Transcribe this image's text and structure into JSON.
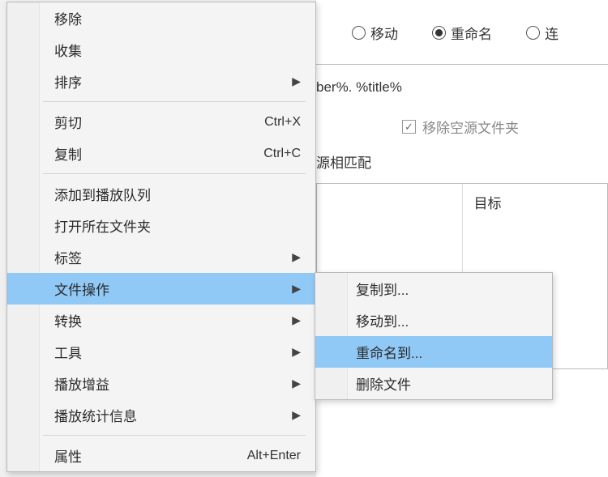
{
  "right_panel": {
    "radios": {
      "move": "移动",
      "rename": "重命名",
      "link": "连",
      "selected": "rename"
    },
    "filename_hint": "ber%. %title%",
    "checkbox_label": "移除空源文件夹",
    "match_label": "源相匹配",
    "col_source": "",
    "col_target": "目标"
  },
  "context_menu": {
    "items": [
      {
        "id": "remove",
        "label": "移除"
      },
      {
        "id": "collect",
        "label": "收集"
      },
      {
        "id": "sort",
        "label": "排序",
        "submenu": true
      },
      {
        "sep": true
      },
      {
        "id": "cut",
        "label": "剪切",
        "shortcut": "Ctrl+X"
      },
      {
        "id": "copy",
        "label": "复制",
        "shortcut": "Ctrl+C"
      },
      {
        "sep": true
      },
      {
        "id": "addqueue",
        "label": "添加到播放队列"
      },
      {
        "id": "openin",
        "label": "打开所在文件夹"
      },
      {
        "id": "tags",
        "label": "标签",
        "submenu": true
      },
      {
        "id": "fileops",
        "label": "文件操作",
        "submenu": true,
        "highlight": true
      },
      {
        "id": "convert",
        "label": "转换",
        "submenu": true
      },
      {
        "id": "tools",
        "label": "工具",
        "submenu": true
      },
      {
        "id": "replaygain",
        "label": "播放增益",
        "submenu": true
      },
      {
        "id": "playstats",
        "label": "播放统计信息",
        "submenu": true
      },
      {
        "sep": true
      },
      {
        "id": "props",
        "label": "属性",
        "shortcut": "Alt+Enter"
      }
    ]
  },
  "submenu": {
    "items": [
      {
        "id": "copyto",
        "label": "复制到..."
      },
      {
        "id": "moveto",
        "label": "移动到..."
      },
      {
        "id": "renameto",
        "label": "重命名到...",
        "highlight": true
      },
      {
        "id": "delete",
        "label": "删除文件"
      }
    ]
  }
}
